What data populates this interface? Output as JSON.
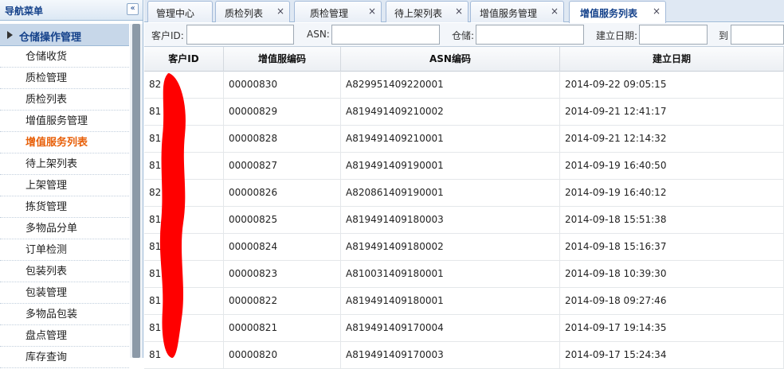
{
  "sidebar": {
    "title": "导航菜单",
    "collapse_glyph": "«",
    "group_label": "仓储操作管理",
    "items": [
      {
        "label": "仓储收货"
      },
      {
        "label": "质检管理"
      },
      {
        "label": "质检列表"
      },
      {
        "label": "增值服务管理"
      },
      {
        "label": "增值服务列表",
        "active": true
      },
      {
        "label": "待上架列表"
      },
      {
        "label": "上架管理"
      },
      {
        "label": "拣货管理"
      },
      {
        "label": "多物品分单"
      },
      {
        "label": "订单检测"
      },
      {
        "label": "包装列表"
      },
      {
        "label": "包装管理"
      },
      {
        "label": "多物品包装"
      },
      {
        "label": "盘点管理"
      },
      {
        "label": "库存查询"
      }
    ]
  },
  "tabs": [
    {
      "label": "管理中心",
      "closable": false
    },
    {
      "label": "质检列表",
      "closable": true
    },
    {
      "label": "质检管理",
      "closable": true
    },
    {
      "label": "待上架列表",
      "closable": true
    },
    {
      "label": "增值服务管理",
      "closable": true
    },
    {
      "label": "增值服务列表",
      "closable": true,
      "active": true
    }
  ],
  "close_glyph": "×",
  "filters": {
    "customer_id_label": "客户ID:",
    "customer_id_value": "",
    "asn_label": "ASN:",
    "asn_value": "",
    "warehouse_label": "仓储:",
    "warehouse_value": "",
    "date_label": "建立日期:",
    "date_from_value": "",
    "to_label": "到",
    "date_to_value": ""
  },
  "table": {
    "columns": [
      "客户ID",
      "增值服编码",
      "ASN编码",
      "建立日期"
    ],
    "rows": [
      {
        "customer_id": "82",
        "code": "00000830",
        "asn": "A829951409220001",
        "date": "2014-09-22 09:05:15"
      },
      {
        "customer_id": "81",
        "code": "00000829",
        "asn": "A819491409210002",
        "date": "2014-09-21 12:41:17"
      },
      {
        "customer_id": "81",
        "code": "00000828",
        "asn": "A819491409210001",
        "date": "2014-09-21 12:14:32"
      },
      {
        "customer_id": "81",
        "code": "00000827",
        "asn": "A819491409190001",
        "date": "2014-09-19 16:40:50"
      },
      {
        "customer_id": "82",
        "code": "00000826",
        "asn": "A820861409190001",
        "date": "2014-09-19 16:40:12"
      },
      {
        "customer_id": "81",
        "code": "00000825",
        "asn": "A819491409180003",
        "date": "2014-09-18 15:51:38"
      },
      {
        "customer_id": "81",
        "code": "00000824",
        "asn": "A819491409180002",
        "date": "2014-09-18 15:16:37"
      },
      {
        "customer_id": "81",
        "code": "00000823",
        "asn": "A810031409180001",
        "date": "2014-09-18 10:39:30"
      },
      {
        "customer_id": "81",
        "code": "00000822",
        "asn": "A819491409180001",
        "date": "2014-09-18 09:27:46"
      },
      {
        "customer_id": "81",
        "code": "00000821",
        "asn": "A819491409170004",
        "date": "2014-09-17 19:14:35"
      },
      {
        "customer_id": "81",
        "code": "00000820",
        "asn": "A819491409170003",
        "date": "2014-09-17 15:24:34"
      }
    ]
  },
  "colors": {
    "accent": "#15428b",
    "active_menu": "#e8600a",
    "redaction": "#ff0000"
  }
}
